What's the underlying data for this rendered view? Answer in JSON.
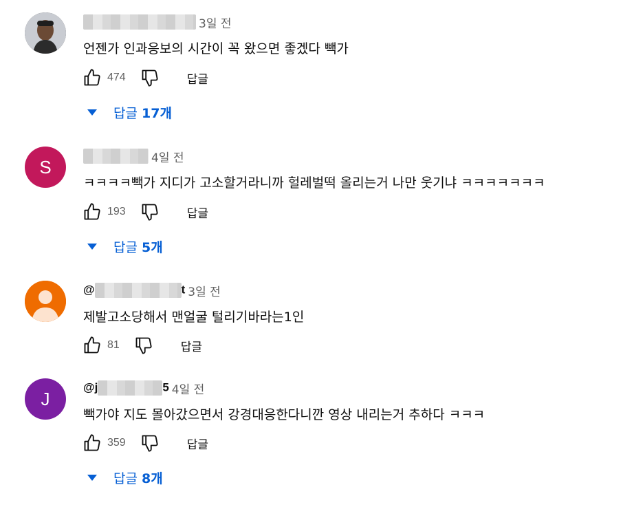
{
  "comments": [
    {
      "author": "",
      "time": "3일 전",
      "text": "언젠가 인과응보의 시간이 꼭 왔으면 좋겠다 빽가",
      "likes": "474",
      "reply_label": "답글",
      "replies_prefix": "답글",
      "replies_count": "17개",
      "avatar_letter": "",
      "avatar_color": "#3a3a3a"
    },
    {
      "author": "",
      "time": "4일 전",
      "text": "ㅋㅋㅋㅋ빽가 지디가 고소할거라니까 헐레벌떡 올리는거 나만 웃기냐 ㅋㅋㅋㅋㅋㅋㅋ",
      "likes": "193",
      "reply_label": "답글",
      "replies_prefix": "답글",
      "replies_count": "5개",
      "avatar_letter": "S",
      "avatar_color": "#c2185b"
    },
    {
      "author_start": "@",
      "author_end": "t",
      "time": "3일 전",
      "text": "제발고소당해서 맨얼굴 털리기바라는1인",
      "likes": "81",
      "reply_label": "답글",
      "avatar_letter": "",
      "avatar_color": "#ef6c00"
    },
    {
      "author_start": "@j",
      "author_end": "5",
      "time": "4일 전",
      "text": "빽가야 지도 몰아갔으면서 강경대응한다니깐 영상 내리는거 추하다 ㅋㅋㅋ",
      "likes": "359",
      "reply_label": "답글",
      "replies_prefix": "답글",
      "replies_count": "8개",
      "avatar_letter": "J",
      "avatar_color": "#7b1fa2"
    }
  ],
  "icons": {
    "like": "thumbs-up-icon",
    "dislike": "thumbs-down-icon",
    "expand": "triangle-down-icon"
  },
  "accent_color": "#065fd4"
}
